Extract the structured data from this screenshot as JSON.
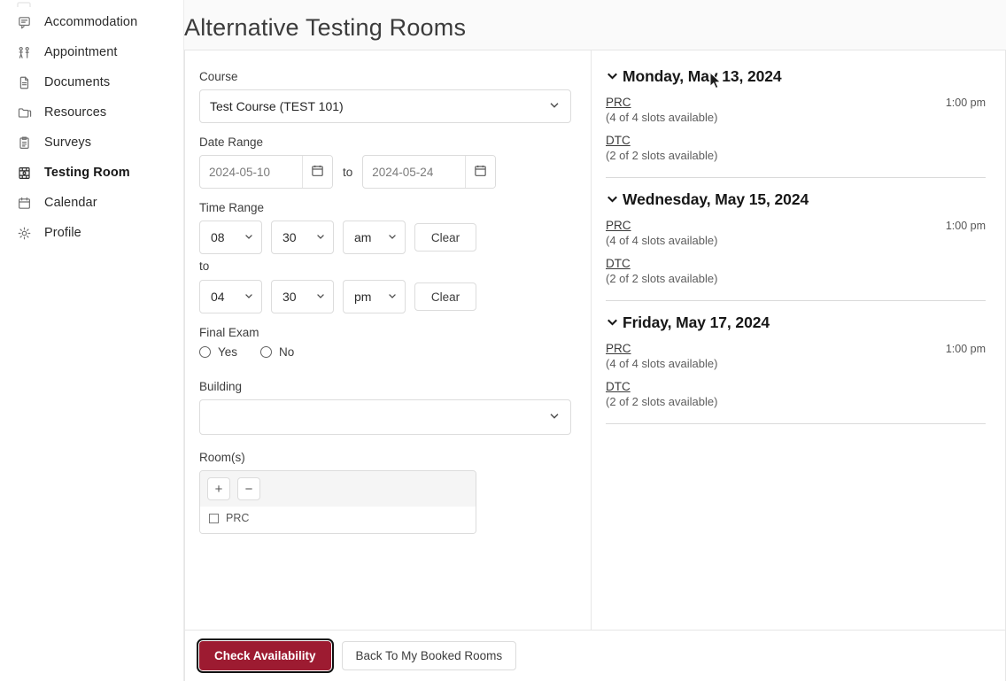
{
  "sidebar": {
    "items": [
      {
        "label": "Accommodation",
        "icon": "chat-bubble-icon",
        "active": false
      },
      {
        "label": "Appointment",
        "icon": "people-icon",
        "active": false
      },
      {
        "label": "Documents",
        "icon": "document-icon",
        "active": false
      },
      {
        "label": "Resources",
        "icon": "folder-icon",
        "active": false
      },
      {
        "label": "Surveys",
        "icon": "clipboard-icon",
        "active": false
      },
      {
        "label": "Testing Room",
        "icon": "building-icon",
        "active": true
      },
      {
        "label": "Calendar",
        "icon": "calendar-icon",
        "active": false
      },
      {
        "label": "Profile",
        "icon": "gear-icon",
        "active": false
      }
    ]
  },
  "header": {
    "title": "Alternative Testing Rooms"
  },
  "form": {
    "course": {
      "label": "Course",
      "value": "Test Course (TEST 101)"
    },
    "date_range": {
      "label": "Date Range",
      "start": "2024-05-10",
      "end": "2024-05-24",
      "separator": "to"
    },
    "time_range": {
      "label": "Time Range",
      "separator": "to",
      "start": {
        "hour": "08",
        "minute": "30",
        "meridiem": "am",
        "clear_label": "Clear"
      },
      "end": {
        "hour": "04",
        "minute": "30",
        "meridiem": "pm",
        "clear_label": "Clear"
      }
    },
    "final_exam": {
      "label": "Final Exam",
      "options": [
        {
          "label": "Yes",
          "selected": false
        },
        {
          "label": "No",
          "selected": false
        }
      ]
    },
    "building": {
      "label": "Building",
      "value": ""
    },
    "rooms": {
      "label": "Room(s)",
      "add_label": "+",
      "remove_label": "−",
      "items": [
        {
          "label": "PRC",
          "checked": false
        }
      ]
    }
  },
  "results": {
    "days": [
      {
        "date": "Monday, May 13, 2024",
        "slots": [
          {
            "room": "PRC",
            "availability": "(4 of 4 slots available)",
            "time": "1:00 pm"
          },
          {
            "room": "DTC",
            "availability": "(2 of 2 slots available)",
            "time": ""
          }
        ]
      },
      {
        "date": "Wednesday, May 15, 2024",
        "slots": [
          {
            "room": "PRC",
            "availability": "(4 of 4 slots available)",
            "time": "1:00 pm"
          },
          {
            "room": "DTC",
            "availability": "(2 of 2 slots available)",
            "time": ""
          }
        ]
      },
      {
        "date": "Friday, May 17, 2024",
        "slots": [
          {
            "room": "PRC",
            "availability": "(4 of 4 slots available)",
            "time": "1:00 pm"
          },
          {
            "room": "DTC",
            "availability": "(2 of 2 slots available)",
            "time": ""
          }
        ]
      }
    ]
  },
  "footer": {
    "primary_label": "Check Availability",
    "secondary_label": "Back To My Booked Rooms"
  },
  "colors": {
    "primary": "#9d1b31",
    "page_bg": "#fafafa",
    "border": "#e6e6e6",
    "text": "#3d3d3d"
  }
}
